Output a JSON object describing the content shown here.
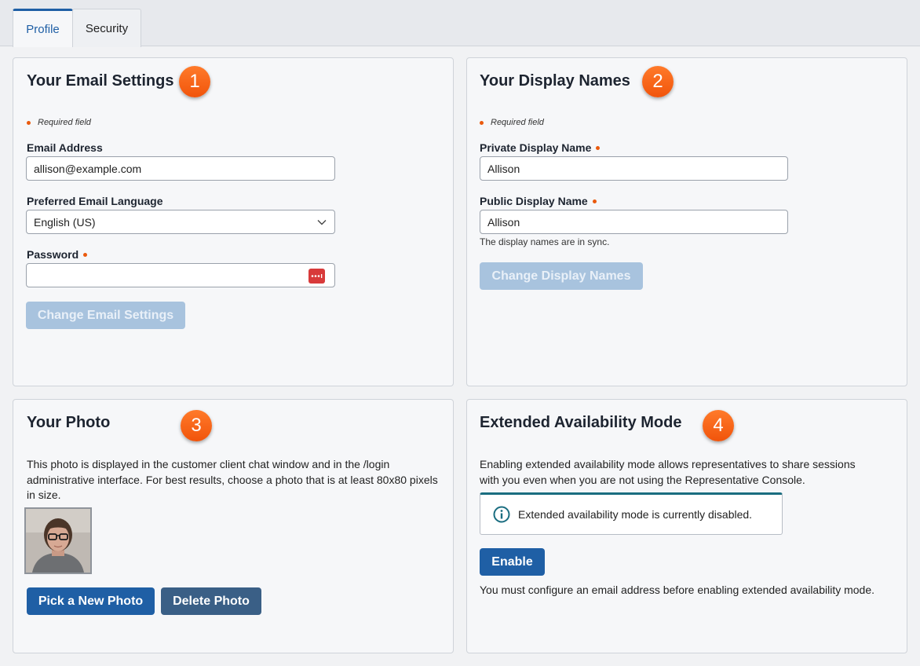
{
  "tabs": [
    {
      "label": "Profile",
      "active": true
    },
    {
      "label": "Security",
      "active": false
    }
  ],
  "email_settings": {
    "title": "Your Email Settings",
    "badge": "1",
    "required_note": "Required field",
    "email_label": "Email Address",
    "email_value": "allison@example.com",
    "language_label": "Preferred Email Language",
    "language_value": "English (US)",
    "password_label": "Password",
    "password_value": "",
    "submit_label": "Change Email Settings"
  },
  "display_names": {
    "title": "Your Display Names",
    "badge": "2",
    "required_note": "Required field",
    "private_label": "Private Display Name",
    "private_value": "Allison",
    "public_label": "Public Display Name",
    "public_value": "Allison",
    "sync_note": "The display names are in sync.",
    "submit_label": "Change Display Names"
  },
  "photo": {
    "title": "Your Photo",
    "badge": "3",
    "description": "This photo is displayed in the customer client chat window and in the /login administrative interface.  For best results, choose a photo that is at least 80x80 pixels in size.",
    "pick_label": "Pick a New Photo",
    "delete_label": "Delete Photo"
  },
  "availability": {
    "title": "Extended Availability Mode",
    "badge": "4",
    "description": "Enabling extended availability mode allows representatives to share sessions with you even when you are not using the Representative Console.",
    "status_message": "Extended availability mode is currently disabled.",
    "enable_label": "Enable",
    "footnote": "You must configure an email address before enabling extended availability mode."
  },
  "colors": {
    "accent": "#1f5fa5",
    "badge": "#f1540b",
    "required": "#ea5a0e",
    "disabled_button": "#a8c3de",
    "info": "#1a6d80"
  }
}
